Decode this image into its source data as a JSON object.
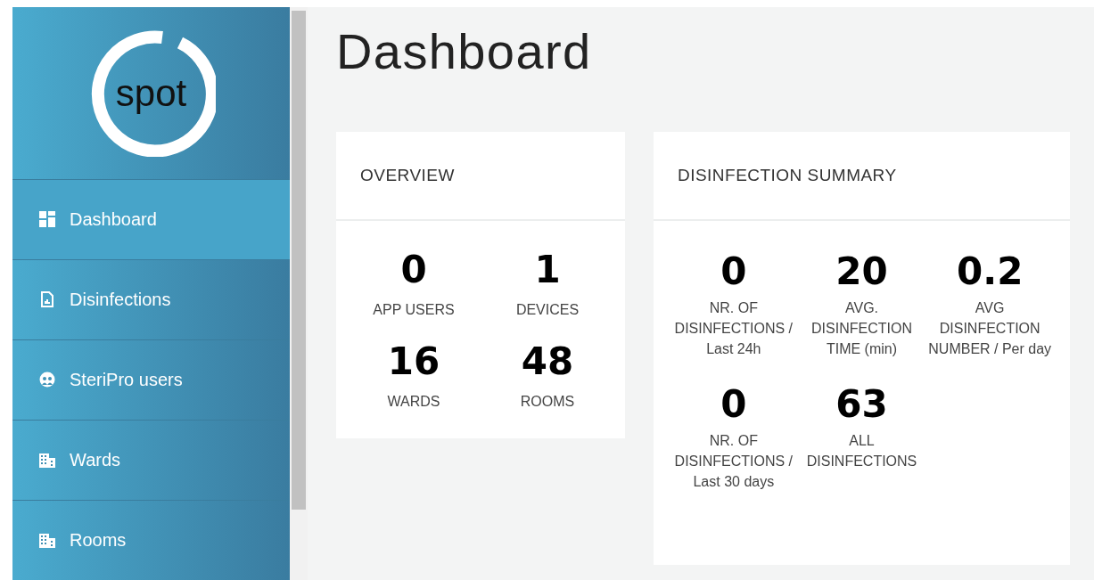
{
  "logo": {
    "text": "spot"
  },
  "sidebar": {
    "items": [
      {
        "label": "Dashboard",
        "selected": true
      },
      {
        "label": "Disinfections",
        "selected": false
      },
      {
        "label": "SteriPro users",
        "selected": false
      },
      {
        "label": "Wards",
        "selected": false
      },
      {
        "label": "Rooms",
        "selected": false
      }
    ]
  },
  "page_title": "Dashboard",
  "overview": {
    "title": "OVERVIEW",
    "stats": [
      {
        "value": "0",
        "label": "APP USERS"
      },
      {
        "value": "1",
        "label": "DEVICES"
      },
      {
        "value": "16",
        "label": "WARDS"
      },
      {
        "value": "48",
        "label": "ROOMS"
      }
    ]
  },
  "disinfection_summary": {
    "title": "DISINFECTION SUMMARY",
    "stats": [
      {
        "value": "0",
        "label": "NR. OF DISINFECTIONS / Last 24h"
      },
      {
        "value": "20",
        "label": "AVG. DISINFECTION TIME (min)"
      },
      {
        "value": "0.2",
        "label": "AVG DISINFECTION NUMBER / Per day"
      },
      {
        "value": "0",
        "label": "NR. OF DISINFECTIONS / Last 30 days"
      },
      {
        "value": "63",
        "label": "ALL DISINFECTIONS"
      }
    ]
  }
}
